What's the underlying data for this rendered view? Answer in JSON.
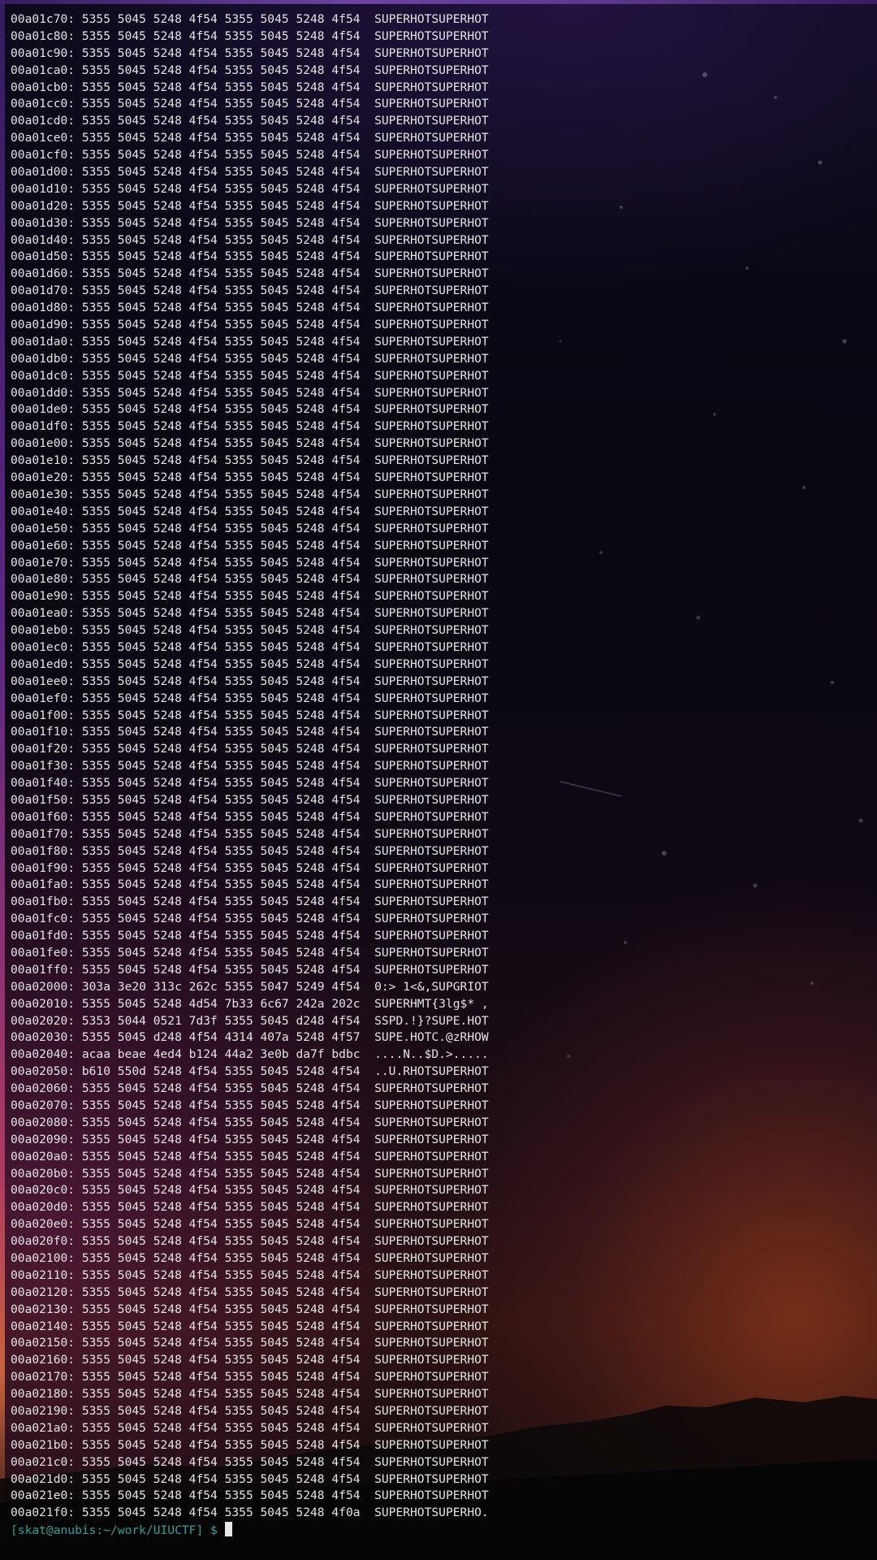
{
  "terminal": {
    "lines": [
      "00a01c70: 5355 5045 5248 4f54 5355 5045 5248 4f54  SUPERHOTSUPERHOT",
      "00a01c80: 5355 5045 5248 4f54 5355 5045 5248 4f54  SUPERHOTSUPERHOT",
      "00a01c90: 5355 5045 5248 4f54 5355 5045 5248 4f54  SUPERHOTSUPERHOT",
      "00a01ca0: 5355 5045 5248 4f54 5355 5045 5248 4f54  SUPERHOTSUPERHOT",
      "00a01cb0: 5355 5045 5248 4f54 5355 5045 5248 4f54  SUPERHOTSUPERHOT",
      "00a01cc0: 5355 5045 5248 4f54 5355 5045 5248 4f54  SUPERHOTSUPERHOT",
      "00a01cd0: 5355 5045 5248 4f54 5355 5045 5248 4f54  SUPERHOTSUPERHOT",
      "00a01ce0: 5355 5045 5248 4f54 5355 5045 5248 4f54  SUPERHOTSUPERHOT",
      "00a01cf0: 5355 5045 5248 4f54 5355 5045 5248 4f54  SUPERHOTSUPERHOT",
      "00a01d00: 5355 5045 5248 4f54 5355 5045 5248 4f54  SUPERHOTSUPERHOT",
      "00a01d10: 5355 5045 5248 4f54 5355 5045 5248 4f54  SUPERHOTSUPERHOT",
      "00a01d20: 5355 5045 5248 4f54 5355 5045 5248 4f54  SUPERHOTSUPERHOT",
      "00a01d30: 5355 5045 5248 4f54 5355 5045 5248 4f54  SUPERHOTSUPERHOT",
      "00a01d40: 5355 5045 5248 4f54 5355 5045 5248 4f54  SUPERHOTSUPERHOT",
      "00a01d50: 5355 5045 5248 4f54 5355 5045 5248 4f54  SUPERHOTSUPERHOT",
      "00a01d60: 5355 5045 5248 4f54 5355 5045 5248 4f54  SUPERHOTSUPERHOT",
      "00a01d70: 5355 5045 5248 4f54 5355 5045 5248 4f54  SUPERHOTSUPERHOT",
      "00a01d80: 5355 5045 5248 4f54 5355 5045 5248 4f54  SUPERHOTSUPERHOT",
      "00a01d90: 5355 5045 5248 4f54 5355 5045 5248 4f54  SUPERHOTSUPERHOT",
      "00a01da0: 5355 5045 5248 4f54 5355 5045 5248 4f54  SUPERHOTSUPERHOT",
      "00a01db0: 5355 5045 5248 4f54 5355 5045 5248 4f54  SUPERHOTSUPERHOT",
      "00a01dc0: 5355 5045 5248 4f54 5355 5045 5248 4f54  SUPERHOTSUPERHOT",
      "00a01dd0: 5355 5045 5248 4f54 5355 5045 5248 4f54  SUPERHOTSUPERHOT",
      "00a01de0: 5355 5045 5248 4f54 5355 5045 5248 4f54  SUPERHOTSUPERHOT",
      "00a01df0: 5355 5045 5248 4f54 5355 5045 5248 4f54  SUPERHOTSUPERHOT",
      "00a01e00: 5355 5045 5248 4f54 5355 5045 5248 4f54  SUPERHOTSUPERHOT",
      "00a01e10: 5355 5045 5248 4f54 5355 5045 5248 4f54  SUPERHOTSUPERHOT",
      "00a01e20: 5355 5045 5248 4f54 5355 5045 5248 4f54  SUPERHOTSUPERHOT",
      "00a01e30: 5355 5045 5248 4f54 5355 5045 5248 4f54  SUPERHOTSUPERHOT",
      "00a01e40: 5355 5045 5248 4f54 5355 5045 5248 4f54  SUPERHOTSUPERHOT",
      "00a01e50: 5355 5045 5248 4f54 5355 5045 5248 4f54  SUPERHOTSUPERHOT",
      "00a01e60: 5355 5045 5248 4f54 5355 5045 5248 4f54  SUPERHOTSUPERHOT",
      "00a01e70: 5355 5045 5248 4f54 5355 5045 5248 4f54  SUPERHOTSUPERHOT",
      "00a01e80: 5355 5045 5248 4f54 5355 5045 5248 4f54  SUPERHOTSUPERHOT",
      "00a01e90: 5355 5045 5248 4f54 5355 5045 5248 4f54  SUPERHOTSUPERHOT",
      "00a01ea0: 5355 5045 5248 4f54 5355 5045 5248 4f54  SUPERHOTSUPERHOT",
      "00a01eb0: 5355 5045 5248 4f54 5355 5045 5248 4f54  SUPERHOTSUPERHOT",
      "00a01ec0: 5355 5045 5248 4f54 5355 5045 5248 4f54  SUPERHOTSUPERHOT",
      "00a01ed0: 5355 5045 5248 4f54 5355 5045 5248 4f54  SUPERHOTSUPERHOT",
      "00a01ee0: 5355 5045 5248 4f54 5355 5045 5248 4f54  SUPERHOTSUPERHOT",
      "00a01ef0: 5355 5045 5248 4f54 5355 5045 5248 4f54  SUPERHOTSUPERHOT",
      "00a01f00: 5355 5045 5248 4f54 5355 5045 5248 4f54  SUPERHOTSUPERHOT",
      "00a01f10: 5355 5045 5248 4f54 5355 5045 5248 4f54  SUPERHOTSUPERHOT",
      "00a01f20: 5355 5045 5248 4f54 5355 5045 5248 4f54  SUPERHOTSUPERHOT",
      "00a01f30: 5355 5045 5248 4f54 5355 5045 5248 4f54  SUPERHOTSUPERHOT",
      "00a01f40: 5355 5045 5248 4f54 5355 5045 5248 4f54  SUPERHOTSUPERHOT",
      "00a01f50: 5355 5045 5248 4f54 5355 5045 5248 4f54  SUPERHOTSUPERHOT",
      "00a01f60: 5355 5045 5248 4f54 5355 5045 5248 4f54  SUPERHOTSUPERHOT",
      "00a01f70: 5355 5045 5248 4f54 5355 5045 5248 4f54  SUPERHOTSUPERHOT",
      "00a01f80: 5355 5045 5248 4f54 5355 5045 5248 4f54  SUPERHOTSUPERHOT",
      "00a01f90: 5355 5045 5248 4f54 5355 5045 5248 4f54  SUPERHOTSUPERHOT",
      "00a01fa0: 5355 5045 5248 4f54 5355 5045 5248 4f54  SUPERHOTSUPERHOT",
      "00a01fb0: 5355 5045 5248 4f54 5355 5045 5248 4f54  SUPERHOTSUPERHOT",
      "00a01fc0: 5355 5045 5248 4f54 5355 5045 5248 4f54  SUPERHOTSUPERHOT",
      "00a01fd0: 5355 5045 5248 4f54 5355 5045 5248 4f54  SUPERHOTSUPERHOT",
      "00a01fe0: 5355 5045 5248 4f54 5355 5045 5248 4f54  SUPERHOTSUPERHOT",
      "00a01ff0: 5355 5045 5248 4f54 5355 5045 5248 4f54  SUPERHOTSUPERHOT",
      "00a02000: 303a 3e20 313c 262c 5355 5047 5249 4f54  0:> 1<&,SUPGRIOT",
      "00a02010: 5355 5045 5248 4d54 7b33 6c67 242a 202c  SUPERHMT{3lg$* ,",
      "00a02020: 5353 5044 0521 7d3f 5355 5045 d248 4f54  SSPD.!}?SUPE.HOT",
      "00a02030: 5355 5045 d248 4f54 4314 407a 5248 4f57  SUPE.HOTC.@zRHOW",
      "00a02040: acaa beae 4ed4 b124 44a2 3e0b da7f bdbc  ....N..$D.>.....",
      "00a02050: b610 550d 5248 4f54 5355 5045 5248 4f54  ..U.RHOTSUPERHOT",
      "00a02060: 5355 5045 5248 4f54 5355 5045 5248 4f54  SUPERHOTSUPERHOT",
      "00a02070: 5355 5045 5248 4f54 5355 5045 5248 4f54  SUPERHOTSUPERHOT",
      "00a02080: 5355 5045 5248 4f54 5355 5045 5248 4f54  SUPERHOTSUPERHOT",
      "00a02090: 5355 5045 5248 4f54 5355 5045 5248 4f54  SUPERHOTSUPERHOT",
      "00a020a0: 5355 5045 5248 4f54 5355 5045 5248 4f54  SUPERHOTSUPERHOT",
      "00a020b0: 5355 5045 5248 4f54 5355 5045 5248 4f54  SUPERHOTSUPERHOT",
      "00a020c0: 5355 5045 5248 4f54 5355 5045 5248 4f54  SUPERHOTSUPERHOT",
      "00a020d0: 5355 5045 5248 4f54 5355 5045 5248 4f54  SUPERHOTSUPERHOT",
      "00a020e0: 5355 5045 5248 4f54 5355 5045 5248 4f54  SUPERHOTSUPERHOT",
      "00a020f0: 5355 5045 5248 4f54 5355 5045 5248 4f54  SUPERHOTSUPERHOT",
      "00a02100: 5355 5045 5248 4f54 5355 5045 5248 4f54  SUPERHOTSUPERHOT",
      "00a02110: 5355 5045 5248 4f54 5355 5045 5248 4f54  SUPERHOTSUPERHOT",
      "00a02120: 5355 5045 5248 4f54 5355 5045 5248 4f54  SUPERHOTSUPERHOT",
      "00a02130: 5355 5045 5248 4f54 5355 5045 5248 4f54  SUPERHOTSUPERHOT",
      "00a02140: 5355 5045 5248 4f54 5355 5045 5248 4f54  SUPERHOTSUPERHOT",
      "00a02150: 5355 5045 5248 4f54 5355 5045 5248 4f54  SUPERHOTSUPERHOT",
      "00a02160: 5355 5045 5248 4f54 5355 5045 5248 4f54  SUPERHOTSUPERHOT",
      "00a02170: 5355 5045 5248 4f54 5355 5045 5248 4f54  SUPERHOTSUPERHOT",
      "00a02180: 5355 5045 5248 4f54 5355 5045 5248 4f54  SUPERHOTSUPERHOT",
      "00a02190: 5355 5045 5248 4f54 5355 5045 5248 4f54  SUPERHOTSUPERHOT",
      "00a021a0: 5355 5045 5248 4f54 5355 5045 5248 4f54  SUPERHOTSUPERHOT",
      "00a021b0: 5355 5045 5248 4f54 5355 5045 5248 4f54  SUPERHOTSUPERHOT",
      "00a021c0: 5355 5045 5248 4f54 5355 5045 5248 4f54  SUPERHOTSUPERHOT",
      "00a021d0: 5355 5045 5248 4f54 5355 5045 5248 4f54  SUPERHOTSUPERHOT",
      "00a021e0: 5355 5045 5248 4f54 5355 5045 5248 4f54  SUPERHOTSUPERHOT",
      "00a021f0: 5355 5045 5248 4f54 5355 5045 5248 4f0a  SUPERHOTSUPERHO."
    ],
    "prompt": "[skat@anubis:~/work/UIUCTF] $ ",
    "colors": {
      "text": "#e4e4e4",
      "prompt": "#2aa198",
      "cursor": "#e8e8e8",
      "background": "#07070c"
    }
  }
}
